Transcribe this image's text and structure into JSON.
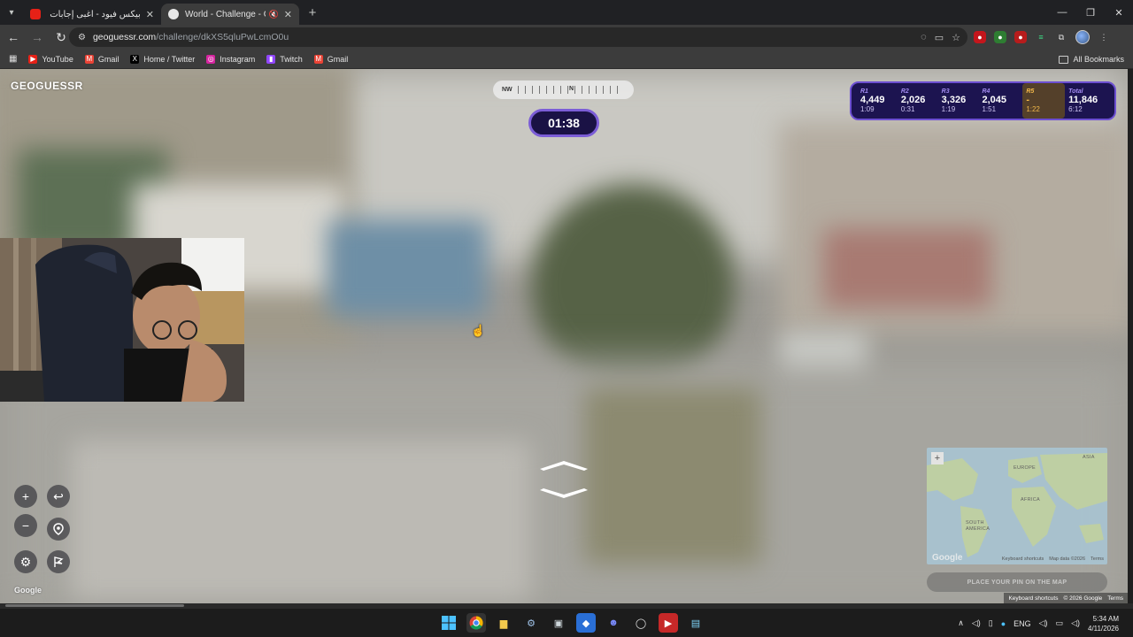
{
  "browser": {
    "tabs": [
      {
        "title": "بيكس فيود - أغبى إجابات صناع ها",
        "favicon_color": "#e62117",
        "active": false
      },
      {
        "title": "World - Challenge - GeoGu",
        "favicon_color": "#e8e8e8",
        "active": true
      }
    ],
    "url_host": "geoguessr.com",
    "url_path": "/challenge/dkXS5qluPwLcmO0u",
    "bookmarks": [
      {
        "label": "YouTube",
        "icon": "youtube-icon",
        "color": "#e62117"
      },
      {
        "label": "Gmail",
        "icon": "gmail-icon",
        "color": "#ea4335"
      },
      {
        "label": "Home / Twitter",
        "icon": "x-icon",
        "color": "#000000"
      },
      {
        "label": "Instagram",
        "icon": "instagram-icon",
        "color": "#d6249f"
      },
      {
        "label": "Twitch",
        "icon": "twitch-icon",
        "color": "#9146ff"
      },
      {
        "label": "Gmail",
        "icon": "gmail-icon",
        "color": "#ea4335"
      }
    ],
    "all_bookmarks_label": "All Bookmarks"
  },
  "game": {
    "logo": "GEOGUESSR",
    "compass_left": "NW",
    "compass_center": "N",
    "timer": "01:38",
    "rounds": [
      {
        "label": "R1",
        "points": "4,449",
        "time": "1:09"
      },
      {
        "label": "R2",
        "points": "2,026",
        "time": "0:31"
      },
      {
        "label": "R3",
        "points": "3,326",
        "time": "1:19"
      },
      {
        "label": "R4",
        "points": "2,045",
        "time": "1:51"
      },
      {
        "label": "R5",
        "points": "-",
        "time": "1:22"
      }
    ],
    "total": {
      "label": "Total",
      "points": "11,846",
      "time": "6:12"
    },
    "google_mark": "Google",
    "footer": {
      "shortcuts": "Keyboard shortcuts",
      "copyright": "© 2026 Google",
      "terms": "Terms"
    },
    "minimap": {
      "labels": [
        "EUROPE",
        "ASIA",
        "AFRICA",
        "SOUTH AMERICA"
      ],
      "footer_shortcuts": "Keyboard shortcuts",
      "footer_data": "Map data ©2026",
      "footer_terms": "Terms",
      "logo": "Google"
    },
    "guess_button": "PLACE YOUR PIN ON THE MAP"
  },
  "taskbar": {
    "language": "ENG",
    "time": "5:34 AM",
    "date": "4/11/2026"
  }
}
